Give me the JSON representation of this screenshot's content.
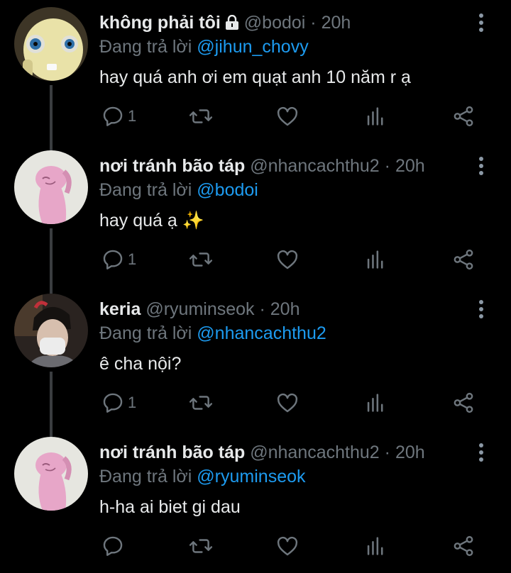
{
  "reply_prefix": "Đang trả lời",
  "separator": "·",
  "colors": {
    "background": "#000000",
    "text": "#e7e9ea",
    "muted": "#6e767d",
    "link": "#1d9bf0"
  },
  "icons": {
    "reply": "speech-bubble-icon",
    "retweet": "retweet-icon",
    "like": "heart-icon",
    "stats": "bar-chart-icon",
    "share": "share-icon",
    "more": "vertical-dots-icon",
    "lock": "lock-icon"
  },
  "tweets": [
    {
      "name": "không phải tôi",
      "handle": "@bodoi",
      "time": "20h",
      "reply_to": "@jihun_chovy",
      "text": "hay quá anh ơi em quạt anh 10 năm r ạ",
      "reply_count": "1"
    },
    {
      "name": "nơi tránh bão táp",
      "handle": "@nhancachthu2",
      "time": "20h",
      "reply_to": "@bodoi",
      "text": "hay quá ạ ✨",
      "reply_count": "1"
    },
    {
      "name": "keria",
      "handle": "@ryuminseok",
      "time": "20h",
      "reply_to": "@nhancachthu2",
      "text": "ê cha nội?",
      "reply_count": "1"
    },
    {
      "name": "nơi tránh bão táp",
      "handle": "@nhancachthu2",
      "time": "20h",
      "reply_to": "@ryuminseok",
      "text": "h-ha ai biet gi dau",
      "reply_count": ""
    }
  ]
}
